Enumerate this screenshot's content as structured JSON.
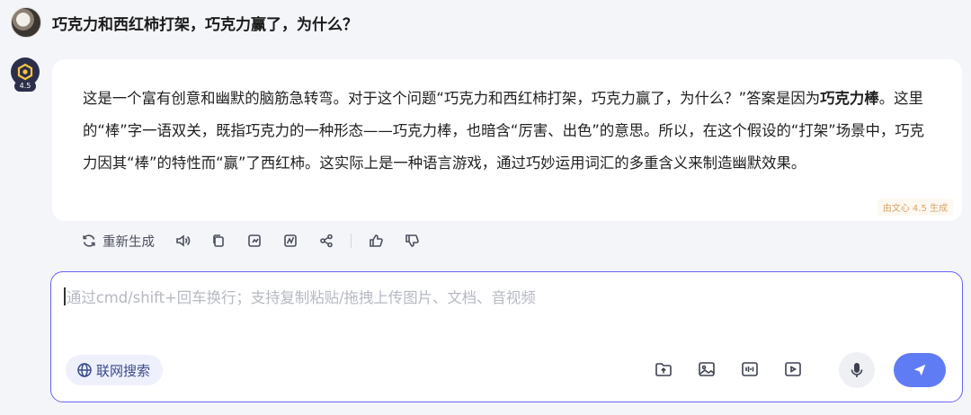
{
  "user": {
    "question": "巧克力和西红柿打架，巧克力赢了，为什么？"
  },
  "bot": {
    "version_badge": "4.5",
    "answer": {
      "p1": "这是一个富有创意和幽默的脑筋急转弯。对于这个问题“巧克力和西红柿打架，巧克力赢了，为什么？”答案是因为",
      "bold": "巧克力棒",
      "p2": "。这里的“棒”字一语双关，既指巧克力的一种形态——巧克力棒，也暗含“厉害、出色”的意思。所以，在这个假设的“打架”场景中，巧克力因其“棒”的特性而“赢”了西红柿。这实际上是一种语言游戏，通过巧妙运用词汇的多重含义来制造幽默效果。"
    },
    "generated_by": "由文心 4.5 生成"
  },
  "actions": {
    "regenerate_label": "重新生成",
    "icons": [
      "refresh-icon",
      "speaker-icon",
      "copy-icon",
      "export-icon",
      "chart-icon",
      "share-icon",
      "thumbs-up-icon",
      "thumbs-down-icon"
    ]
  },
  "composer": {
    "placeholder": "通过cmd/shift+回车换行；支持复制粘贴/拖拽上传图片、文档、音视频",
    "web_search_label": "联网搜索"
  },
  "colors": {
    "page_bg": "#f4f5f9",
    "accent_border": "#6b63f4",
    "send_button": "#5f7cf5",
    "badge_text": "#d9a46a"
  }
}
